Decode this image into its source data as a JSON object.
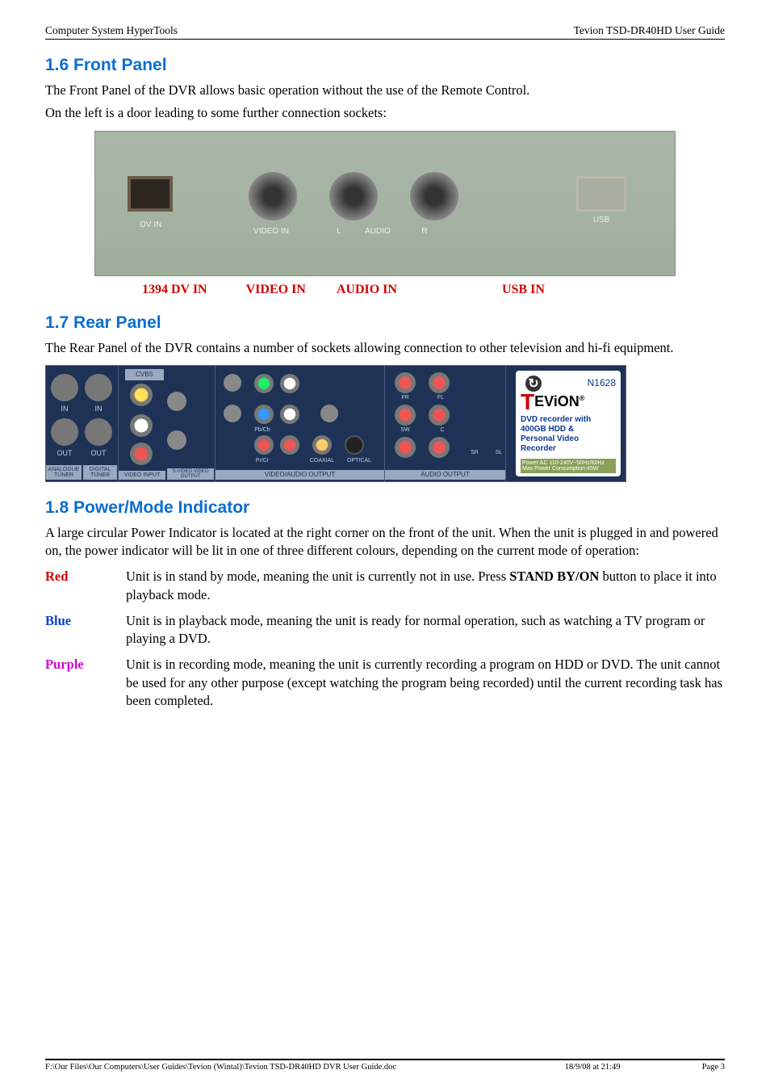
{
  "header": {
    "left": "Computer System HyperTools",
    "right": "Tevion TSD-DR40HD User Guide"
  },
  "section16": {
    "heading": "1.6  Front Panel",
    "p1": "The Front Panel of the DVR allows basic operation without the use of the Remote Control.",
    "p2": "On the left is a door leading to some further connection sockets:",
    "caption": {
      "c1": "1394 DV IN",
      "c2": "VIDEO IN",
      "c3": "AUDIO IN",
      "c4": "USB IN"
    },
    "panel_labels": {
      "dv": "DV IN",
      "video": "VIDEO IN",
      "l": "L",
      "audio": "AUDIO",
      "r": "R",
      "usb": "USB"
    }
  },
  "section17": {
    "heading": "1.7  Rear Panel",
    "p1": "The Rear Panel of the DVR contains a number of sockets allowing connection to other television and hi-fi equipment.",
    "rear": {
      "analog": "ANALOGUE TUNER",
      "digital": "DIGITAL TUNER",
      "in": "IN",
      "out": "OUT",
      "cvbs": "CVBS",
      "video_input": "VIDEO INPUT",
      "svideo": "S-VIDEO VIDEO OUTPUT",
      "video_audio_output": "VIDEO/AUDIO OUTPUT",
      "prcr": "Pr/Cr",
      "pbcb": "Pb/Cb",
      "coax": "COAXIAL",
      "optical": "OPTICAL",
      "audio_output": "AUDIO OUTPUT",
      "sr": "SR",
      "sl": "SL",
      "fr": "FR",
      "fl": "FL",
      "sw": "SW",
      "c": "C",
      "model": "N1628",
      "brand_t": "T",
      "brand_rest": "EViON",
      "brand_reg": "®",
      "desc1": "DVD recorder with",
      "desc2": "400GB HDD &",
      "desc3": "Personal Video",
      "desc4": "Recorder",
      "power1": "Power:AC 110-240V~50Hz/60Hz",
      "power2": "Max Power Consumption:45W"
    }
  },
  "section18": {
    "heading": "1.8  Power/Mode Indicator",
    "p1": "A large circular Power Indicator is located at the right corner on the front of the unit. When the unit is plugged in and powered on, the power indicator will be lit in one of three different colours, depending on the current mode of operation:",
    "rows": {
      "red": {
        "label": "Red",
        "text_pre": "Unit is in stand by mode, meaning the unit is currently not in use. Press ",
        "bold1": "STAND BY/ON",
        "text_post": " button to place it into playback mode."
      },
      "blue": {
        "label": "Blue",
        "text": "Unit is in playback mode, meaning the unit is ready for normal operation, such as watching a TV program or playing a DVD."
      },
      "purple": {
        "label": "Purple",
        "text": "Unit is in recording mode, meaning the unit is currently recording a program on HDD or DVD. The unit cannot be used for any other purpose (except watching the program being recorded) until the current recording task has been completed."
      }
    }
  },
  "footer": {
    "left": "F:\\Our Files\\Our Computers\\User Guides\\Tevion (Wintal)\\Tevion TSD-DR40HD DVR User Guide.doc",
    "mid": "18/9/08 at 21:49",
    "right": "Page 3"
  }
}
